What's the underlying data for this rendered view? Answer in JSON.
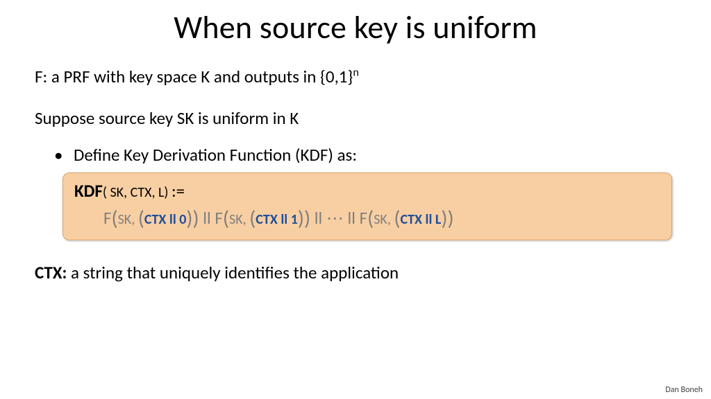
{
  "title": "When source key is uniform",
  "line_f_pre": "F:   a PRF with key space K and outputs in {0,1}",
  "line_f_sup": "n",
  "line_suppose": "Suppose source key SK is uniform in K",
  "bullet_define": "Define Key Derivation Function (KDF) as:",
  "formula": {
    "kdf_label": "KDF",
    "kdf_args": "( SK, CTX, L) ",
    "assign": ":=",
    "f_lbl": "F",
    "open": "(",
    "close": ")",
    "sk_arg": "SK,  ",
    "ctx0": "CTX ll 0",
    "ctx1": "CTX ll 1",
    "ctxL": "CTX ll L",
    "concat": "  ll  ",
    "dots": "⋯"
  },
  "ctx_label": "CTX:",
  "ctx_desc": "   a string that uniquely identifies the application",
  "author": "Dan Boneh"
}
